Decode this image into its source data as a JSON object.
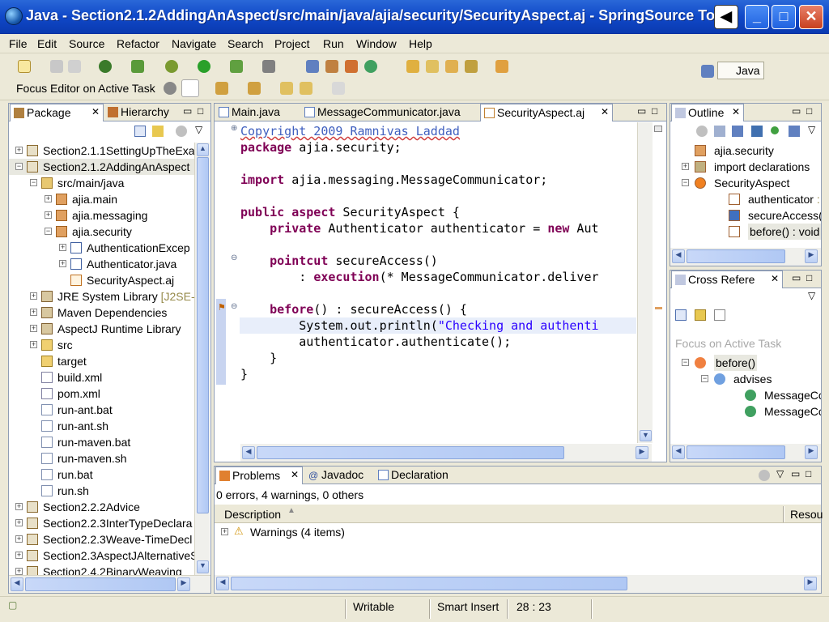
{
  "window": {
    "title": "Java - Section2.1.2AddingAnAspect/src/main/java/ajia/security/SecurityAspect.aj - SpringSource Tool Suite"
  },
  "menu": [
    "File",
    "Edit",
    "Source",
    "Refactor",
    "Navigate",
    "Search",
    "Project",
    "Run",
    "Window",
    "Help"
  ],
  "toolbar": {
    "focus_label": "Focus Editor on Active Task",
    "perspective": "Java"
  },
  "package_explorer": {
    "tabs": [
      "Package",
      "Hierarchy"
    ],
    "items": [
      {
        "label": "Section2.1.1SettingUpTheExa"
      },
      {
        "label": "Section2.1.2AddingAnAspect"
      },
      {
        "label": "src/main/java"
      },
      {
        "label": "ajia.main"
      },
      {
        "label": "ajia.messaging"
      },
      {
        "label": "ajia.security"
      },
      {
        "label": "AuthenticationExcep"
      },
      {
        "label": "Authenticator.java"
      },
      {
        "label": "SecurityAspect.aj"
      },
      {
        "label": "JRE System Library",
        "suffix": "[J2SE-"
      },
      {
        "label": "Maven Dependencies"
      },
      {
        "label": "AspectJ Runtime Library"
      },
      {
        "label": "src"
      },
      {
        "label": "target"
      },
      {
        "label": "build.xml"
      },
      {
        "label": "pom.xml"
      },
      {
        "label": "run-ant.bat"
      },
      {
        "label": "run-ant.sh"
      },
      {
        "label": "run-maven.bat"
      },
      {
        "label": "run-maven.sh"
      },
      {
        "label": "run.bat"
      },
      {
        "label": "run.sh"
      },
      {
        "label": "Section2.2.2Advice"
      },
      {
        "label": "Section2.2.3InterTypeDeclara"
      },
      {
        "label": "Section2.2.3Weave-TimeDecl"
      },
      {
        "label": "Section2.3AspectJAlternativeS"
      },
      {
        "label": "Section2.4.2BinaryWeaving"
      }
    ]
  },
  "editor": {
    "tabs": [
      "Main.java",
      "MessageCommunicator.java",
      "SecurityAspect.aj"
    ],
    "lines": [
      {
        "parts": [
          {
            "t": "Copyright 2009 Ramnivas Laddad",
            "c": "cm"
          }
        ]
      },
      {
        "parts": [
          {
            "t": "package",
            "c": "kw"
          },
          {
            "t": " ajia.security;"
          }
        ]
      },
      {
        "parts": []
      },
      {
        "parts": [
          {
            "t": "import",
            "c": "kw"
          },
          {
            "t": " ajia.messaging.MessageCommunicator;"
          }
        ]
      },
      {
        "parts": []
      },
      {
        "parts": [
          {
            "t": "public",
            "c": "kw"
          },
          {
            "t": " "
          },
          {
            "t": "aspect",
            "c": "kw"
          },
          {
            "t": " SecurityAspect {"
          }
        ]
      },
      {
        "parts": [
          {
            "t": "    "
          },
          {
            "t": "private",
            "c": "kw"
          },
          {
            "t": " Authenticator authenticator = "
          },
          {
            "t": "new",
            "c": "kw"
          },
          {
            "t": " Aut"
          }
        ]
      },
      {
        "parts": []
      },
      {
        "parts": [
          {
            "t": "    "
          },
          {
            "t": "pointcut",
            "c": "kw"
          },
          {
            "t": " secureAccess()"
          }
        ]
      },
      {
        "parts": [
          {
            "t": "        : "
          },
          {
            "t": "execution",
            "c": "kw"
          },
          {
            "t": "(* MessageCommunicator.deliver"
          }
        ]
      },
      {
        "parts": []
      },
      {
        "parts": [
          {
            "t": "    "
          },
          {
            "t": "before",
            "c": "kw"
          },
          {
            "t": "() : secureAccess() {"
          }
        ]
      },
      {
        "parts": [
          {
            "t": "        System.out.println("
          },
          {
            "t": "\"Checking and authenti",
            "c": "st"
          }
        ]
      },
      {
        "parts": [
          {
            "t": "        authenticator.authenticate();"
          }
        ]
      },
      {
        "parts": [
          {
            "t": "    }"
          }
        ]
      },
      {
        "parts": [
          {
            "t": "}"
          }
        ]
      }
    ]
  },
  "outline": {
    "tab": "Outline",
    "items": [
      {
        "label": "ajia.security"
      },
      {
        "label": "import declarations"
      },
      {
        "label": "SecurityAspect"
      },
      {
        "label": "authenticator",
        "suffix": " : A"
      },
      {
        "label": "secureAccess() : vo"
      },
      {
        "label": "before() : void"
      }
    ]
  },
  "cross_ref": {
    "tab": "Cross Refere",
    "focus_placeholder": "Focus on Active Task",
    "items": [
      {
        "label": "before()"
      },
      {
        "label": "advises"
      },
      {
        "label": "MessageCom"
      },
      {
        "label": "MessageCom"
      }
    ]
  },
  "problems": {
    "tabs": [
      "Problems",
      "Javadoc",
      "Declaration"
    ],
    "summary": "0 errors, 4 warnings, 0 others",
    "columns": [
      "Description",
      "Resou"
    ],
    "rows": [
      {
        "label": "Warnings (4 items)"
      }
    ]
  },
  "status": {
    "writable": "Writable",
    "insert": "Smart Insert",
    "position": "28 : 23"
  },
  "colors": {
    "keyword": "#7f0055",
    "comment": "#3f5fbf",
    "string": "#2a00ff",
    "selection": "#e8eefa"
  }
}
